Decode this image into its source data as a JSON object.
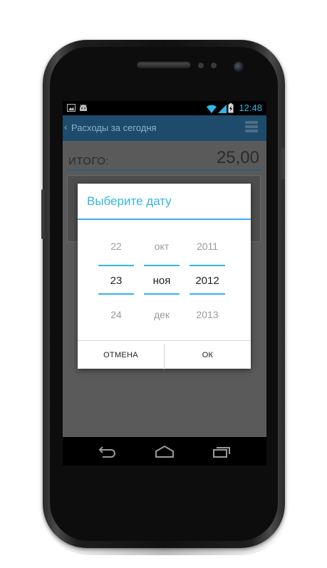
{
  "statusbar": {
    "time": "12:48",
    "left_icons": [
      "image-icon",
      "android-icon"
    ],
    "right_icons": [
      "wifi-icon",
      "signal-icon",
      "battery-charging-icon"
    ]
  },
  "actionbar": {
    "back_glyph": "‹",
    "title": "Расходы за сегодня",
    "menu_icon": "menu-icon"
  },
  "summary": {
    "total_label": "ИТОГО:",
    "total_value": "25,00"
  },
  "dialog": {
    "title": "Выберите дату",
    "day": {
      "prev": "22",
      "selected": "23",
      "next": "24"
    },
    "month": {
      "prev": "окт",
      "selected": "ноя",
      "next": "дек"
    },
    "year": {
      "prev": "2011",
      "selected": "2012",
      "next": "2013"
    },
    "cancel_label": "ОТМЕНА",
    "ok_label": "ОК"
  },
  "navbar": {
    "icons": [
      "back-icon",
      "home-icon",
      "recents-icon"
    ]
  },
  "colors": {
    "accent": "#33b5e5",
    "actionbar": "#1e4b6b",
    "dim_background": "#5a5a5a"
  }
}
